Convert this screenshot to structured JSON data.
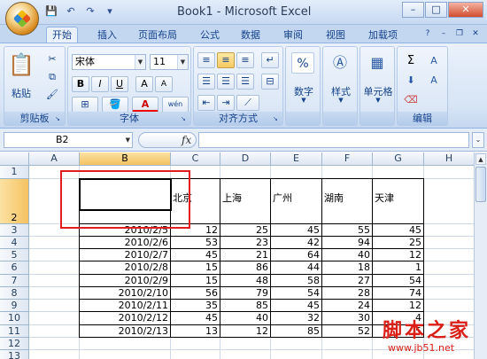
{
  "window": {
    "title": "Book1 - Microsoft Excel",
    "min": "–",
    "max": "□",
    "close": "✕"
  },
  "qat": {
    "save_icon": "floppy-icon",
    "undo": "↶",
    "redo": "↷"
  },
  "tabs": [
    "开始",
    "插入",
    "页面布局",
    "公式",
    "数据",
    "审阅",
    "视图",
    "加载项"
  ],
  "ribbon": {
    "clipboard": {
      "label": "剪贴板",
      "paste": "粘贴"
    },
    "font": {
      "label": "字体",
      "font_name": "宋体",
      "font_size": "11",
      "bold": "B",
      "italic": "I",
      "underline": "U",
      "grow": "A",
      "shrink": "A",
      "font_color": "A",
      "wen": "wén"
    },
    "alignment": {
      "label": "对齐方式"
    },
    "number": {
      "label": "数字",
      "percent": "%"
    },
    "styles": {
      "label": "样式"
    },
    "cells": {
      "label": "单元格"
    },
    "editing": {
      "label": "编辑",
      "sigma": "Σ",
      "sort": "A",
      "find": "A"
    }
  },
  "formula_bar": {
    "name_box": "B2",
    "fx": "fx",
    "formula": ""
  },
  "columns": [
    "A",
    "B",
    "C",
    "D",
    "E",
    "F",
    "G",
    "H"
  ],
  "rows": [
    "1",
    "2",
    "3",
    "4",
    "5",
    "6",
    "7",
    "8",
    "9",
    "10",
    "11",
    "12",
    "13"
  ],
  "headers": [
    "北京",
    "上海",
    "广州",
    "湖南",
    "天津"
  ],
  "data": [
    {
      "date": "2010/2/5",
      "vals": [
        "12",
        "25",
        "45",
        "55",
        "45"
      ]
    },
    {
      "date": "2010/2/6",
      "vals": [
        "53",
        "23",
        "42",
        "94",
        "25"
      ]
    },
    {
      "date": "2010/2/7",
      "vals": [
        "45",
        "21",
        "64",
        "40",
        "12"
      ]
    },
    {
      "date": "2010/2/8",
      "vals": [
        "15",
        "86",
        "44",
        "18",
        "1"
      ]
    },
    {
      "date": "2010/2/9",
      "vals": [
        "15",
        "48",
        "58",
        "27",
        "54"
      ]
    },
    {
      "date": "2010/2/10",
      "vals": [
        "56",
        "79",
        "54",
        "28",
        "74"
      ]
    },
    {
      "date": "2010/2/11",
      "vals": [
        "35",
        "85",
        "45",
        "24",
        "12"
      ]
    },
    {
      "date": "2010/2/12",
      "vals": [
        "45",
        "40",
        "32",
        "30",
        "4"
      ]
    },
    {
      "date": "2010/2/13",
      "vals": [
        "13",
        "12",
        "85",
        "52",
        "5"
      ]
    }
  ],
  "watermark": {
    "title": "脚本之家",
    "url": "www.jb51.net"
  }
}
